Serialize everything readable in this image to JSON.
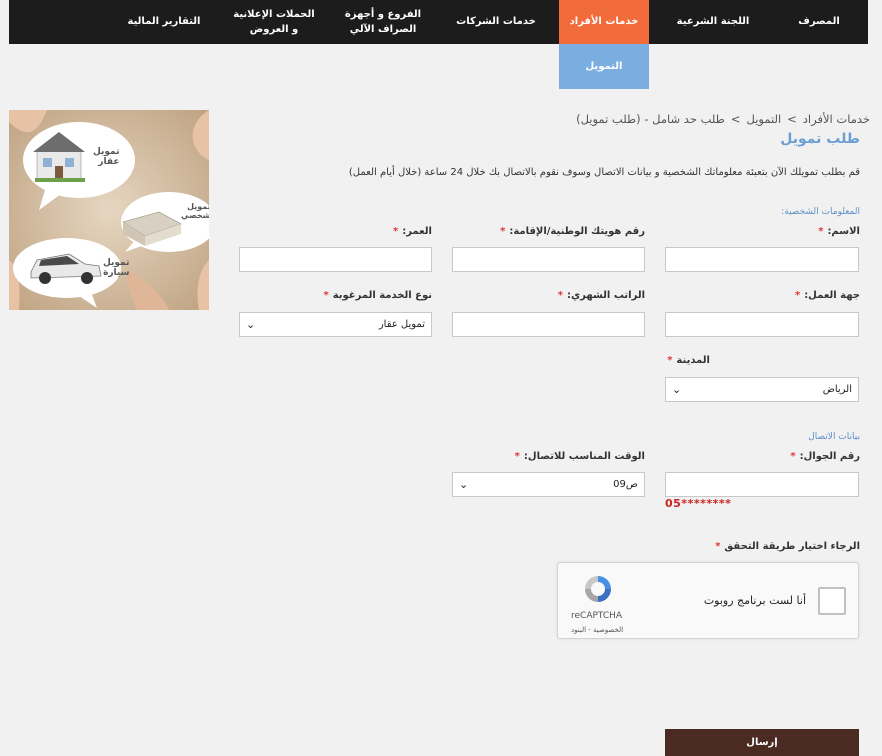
{
  "nav": {
    "items": [
      {
        "label": "المصرف"
      },
      {
        "label": "اللجنة الشرعية"
      },
      {
        "label": "خدمات الأفراد"
      },
      {
        "label": "خدمات الشركات"
      },
      {
        "label": "الفروع و أجهزة\nالصراف الآلي"
      },
      {
        "label": "الحملات الإعلانية\nو العروض"
      },
      {
        "label": "التقارير المالية"
      }
    ],
    "sub_item": "التمويل"
  },
  "promo": {
    "bubble_1": "تمويل\nعقار",
    "bubble_2": "تمويل\nشخصي",
    "bubble_3": "تمويل\nسيارة"
  },
  "breadcrumb": {
    "item_1": "خدمات الأفراد",
    "item_2": "التمويل",
    "item_3": "طلب حد شامل - (طلب تمويل)",
    "separator": ">"
  },
  "page": {
    "title": "طلب تمويل",
    "intro": "قم بطلب تمويلك الآن بتعبئة معلوماتك الشخصية و بيانات الاتصال وسوف نقوم بالاتصال بك خلال 24 ساعة (خلال أيام العمل)"
  },
  "form": {
    "required_mark": "*",
    "personal_section": "المعلومات الشخصية:",
    "name_label": "الاسم:",
    "id_label": "رقم هويتك الوطنية/الإقامة:",
    "age_label": "العمر:",
    "employer_label": "جهة العمل:",
    "salary_label": "الراتب الشهري:",
    "service_label": "نوع الخدمة المرغوبة",
    "service_value": "تمويل عقار",
    "city_label": "المدينة",
    "city_value": "الرياض",
    "contact_section": "بيانات الاتصال",
    "mobile_label": "رقم الجوال:",
    "mobile_hint": "05********",
    "time_label": "الوقت المناسب للاتصال:",
    "time_value": "09ص",
    "verify_label": "الرجاء اختيار طريقة التحقق",
    "submit_label": "إرسال"
  },
  "captcha": {
    "label": "أنا لست برنامج روبوت",
    "brand": "reCAPTCHA",
    "links": "الخصوصية - البنود"
  }
}
